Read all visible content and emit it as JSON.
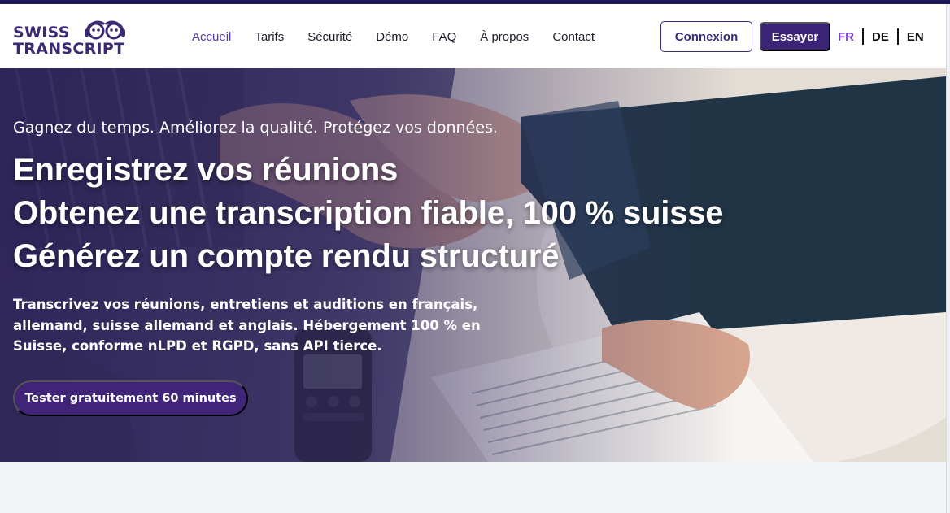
{
  "brand": {
    "line1": "SWISS",
    "line2": "TRANSCRIPT",
    "primary_color": "#3b2476",
    "accent_color": "#7b3fc4",
    "logo_icon": "headphones-face-icon"
  },
  "nav": {
    "links": [
      {
        "label": "Accueil",
        "active": true
      },
      {
        "label": "Tarifs",
        "active": false
      },
      {
        "label": "Sécurité",
        "active": false
      },
      {
        "label": "Démo",
        "active": false
      },
      {
        "label": "FAQ",
        "active": false
      },
      {
        "label": "À propos",
        "active": false
      },
      {
        "label": "Contact",
        "active": false
      }
    ],
    "login_label": "Connexion",
    "try_label": "Essayer",
    "languages": [
      {
        "code": "FR",
        "active": true
      },
      {
        "code": "DE",
        "active": false
      },
      {
        "code": "EN",
        "active": false
      }
    ]
  },
  "hero": {
    "kicker": "Gagnez du temps. Améliorez la qualité. Protégez vos données.",
    "title_lines": [
      "Enregistrez vos réunions",
      "Obtenez une transcription fiable, 100 % suisse",
      "Générez un compte rendu structuré"
    ],
    "description": "Transcrivez vos réunions, entretiens et auditions en français, allemand, suisse allemand et anglais. Hébergement 100 % en Suisse, conforme nLPD et RGPD, sans API tierce.",
    "cta_label": "Tester gratuitement 60 minutes"
  }
}
